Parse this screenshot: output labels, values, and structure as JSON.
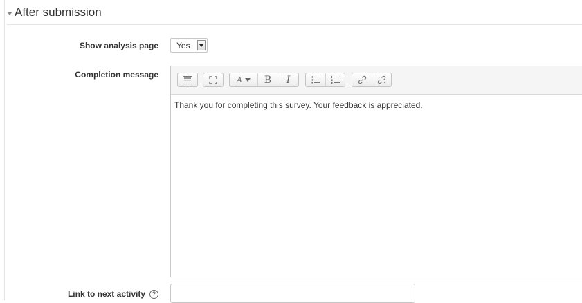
{
  "section": {
    "title": "After submission"
  },
  "show_analysis": {
    "label": "Show analysis page",
    "value": "Yes"
  },
  "completion": {
    "label": "Completion message",
    "text": "Thank you for completing this survey.  Your feedback is appreciated.",
    "toolbar": {
      "toggle_icon": "toolbar-toggle-icon",
      "fullscreen_icon": "fullscreen-icon",
      "font_size_glyph": "A̲",
      "bold_glyph": "B",
      "italic_glyph": "I",
      "bullet_list_icon": "unordered-list-icon",
      "numbered_list_icon": "ordered-list-icon",
      "link_icon": "link-icon",
      "unlink_icon": "unlink-icon"
    }
  },
  "next_activity": {
    "label": "Link to next activity",
    "help_glyph": "?",
    "value": ""
  }
}
